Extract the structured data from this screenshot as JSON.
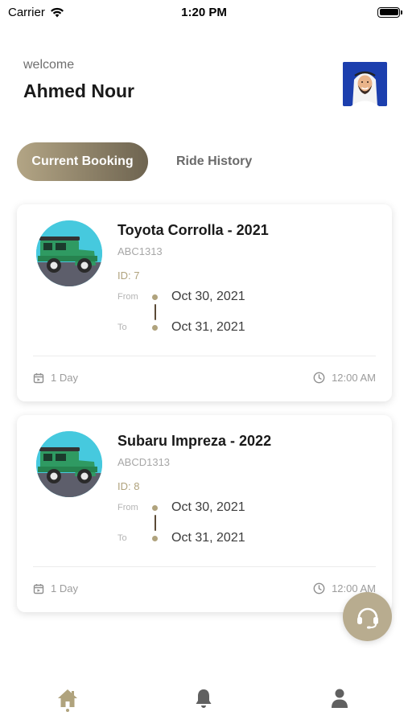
{
  "status_bar": {
    "carrier": "Carrier",
    "time": "1:20 PM"
  },
  "header": {
    "welcome": "welcome",
    "user_name": "Ahmed Nour"
  },
  "tabs": [
    {
      "label": "Current Booking",
      "active": true
    },
    {
      "label": "Ride History",
      "active": false
    }
  ],
  "bookings": [
    {
      "title": "Toyota Corrolla - 2021",
      "plate": "ABC1313",
      "id": "ID: 7",
      "from_label": "From",
      "from_date": "Oct 30, 2021",
      "to_label": "To",
      "to_date": "Oct 31, 2021",
      "duration": "1 Day",
      "time": "12:00 AM"
    },
    {
      "title": "Subaru Impreza - 2022",
      "plate": "ABCD1313",
      "id": "ID: 8",
      "from_label": "From",
      "from_date": "Oct 30, 2021",
      "to_label": "To",
      "to_date": "Oct 31, 2021",
      "duration": "1 Day",
      "time": "12:00 AM"
    }
  ],
  "icons": {
    "wifi": "wifi-icon",
    "battery": "battery-icon",
    "calendar": "calendar-icon",
    "clock": "clock-icon",
    "support": "headset-icon",
    "home": "home-icon",
    "bell": "bell-icon",
    "profile": "user-icon"
  },
  "colors": {
    "accent": "#b0a37d",
    "tab_gradient_start": "#b3a585",
    "tab_gradient_end": "#6e6450",
    "fab": "#b8ac8f",
    "avatar_bg": "#1c3fae"
  }
}
